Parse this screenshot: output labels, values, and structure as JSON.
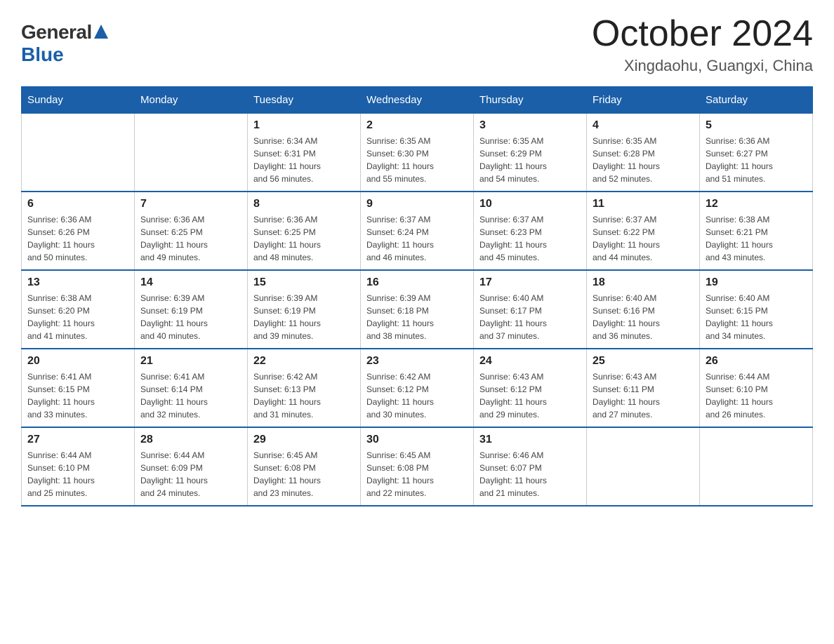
{
  "header": {
    "logo_general": "General",
    "logo_blue": "Blue",
    "month_title": "October 2024",
    "location": "Xingdaohu, Guangxi, China"
  },
  "days_of_week": [
    "Sunday",
    "Monday",
    "Tuesday",
    "Wednesday",
    "Thursday",
    "Friday",
    "Saturday"
  ],
  "weeks": [
    [
      {
        "day": "",
        "info": ""
      },
      {
        "day": "",
        "info": ""
      },
      {
        "day": "1",
        "info": "Sunrise: 6:34 AM\nSunset: 6:31 PM\nDaylight: 11 hours\nand 56 minutes."
      },
      {
        "day": "2",
        "info": "Sunrise: 6:35 AM\nSunset: 6:30 PM\nDaylight: 11 hours\nand 55 minutes."
      },
      {
        "day": "3",
        "info": "Sunrise: 6:35 AM\nSunset: 6:29 PM\nDaylight: 11 hours\nand 54 minutes."
      },
      {
        "day": "4",
        "info": "Sunrise: 6:35 AM\nSunset: 6:28 PM\nDaylight: 11 hours\nand 52 minutes."
      },
      {
        "day": "5",
        "info": "Sunrise: 6:36 AM\nSunset: 6:27 PM\nDaylight: 11 hours\nand 51 minutes."
      }
    ],
    [
      {
        "day": "6",
        "info": "Sunrise: 6:36 AM\nSunset: 6:26 PM\nDaylight: 11 hours\nand 50 minutes."
      },
      {
        "day": "7",
        "info": "Sunrise: 6:36 AM\nSunset: 6:25 PM\nDaylight: 11 hours\nand 49 minutes."
      },
      {
        "day": "8",
        "info": "Sunrise: 6:36 AM\nSunset: 6:25 PM\nDaylight: 11 hours\nand 48 minutes."
      },
      {
        "day": "9",
        "info": "Sunrise: 6:37 AM\nSunset: 6:24 PM\nDaylight: 11 hours\nand 46 minutes."
      },
      {
        "day": "10",
        "info": "Sunrise: 6:37 AM\nSunset: 6:23 PM\nDaylight: 11 hours\nand 45 minutes."
      },
      {
        "day": "11",
        "info": "Sunrise: 6:37 AM\nSunset: 6:22 PM\nDaylight: 11 hours\nand 44 minutes."
      },
      {
        "day": "12",
        "info": "Sunrise: 6:38 AM\nSunset: 6:21 PM\nDaylight: 11 hours\nand 43 minutes."
      }
    ],
    [
      {
        "day": "13",
        "info": "Sunrise: 6:38 AM\nSunset: 6:20 PM\nDaylight: 11 hours\nand 41 minutes."
      },
      {
        "day": "14",
        "info": "Sunrise: 6:39 AM\nSunset: 6:19 PM\nDaylight: 11 hours\nand 40 minutes."
      },
      {
        "day": "15",
        "info": "Sunrise: 6:39 AM\nSunset: 6:19 PM\nDaylight: 11 hours\nand 39 minutes."
      },
      {
        "day": "16",
        "info": "Sunrise: 6:39 AM\nSunset: 6:18 PM\nDaylight: 11 hours\nand 38 minutes."
      },
      {
        "day": "17",
        "info": "Sunrise: 6:40 AM\nSunset: 6:17 PM\nDaylight: 11 hours\nand 37 minutes."
      },
      {
        "day": "18",
        "info": "Sunrise: 6:40 AM\nSunset: 6:16 PM\nDaylight: 11 hours\nand 36 minutes."
      },
      {
        "day": "19",
        "info": "Sunrise: 6:40 AM\nSunset: 6:15 PM\nDaylight: 11 hours\nand 34 minutes."
      }
    ],
    [
      {
        "day": "20",
        "info": "Sunrise: 6:41 AM\nSunset: 6:15 PM\nDaylight: 11 hours\nand 33 minutes."
      },
      {
        "day": "21",
        "info": "Sunrise: 6:41 AM\nSunset: 6:14 PM\nDaylight: 11 hours\nand 32 minutes."
      },
      {
        "day": "22",
        "info": "Sunrise: 6:42 AM\nSunset: 6:13 PM\nDaylight: 11 hours\nand 31 minutes."
      },
      {
        "day": "23",
        "info": "Sunrise: 6:42 AM\nSunset: 6:12 PM\nDaylight: 11 hours\nand 30 minutes."
      },
      {
        "day": "24",
        "info": "Sunrise: 6:43 AM\nSunset: 6:12 PM\nDaylight: 11 hours\nand 29 minutes."
      },
      {
        "day": "25",
        "info": "Sunrise: 6:43 AM\nSunset: 6:11 PM\nDaylight: 11 hours\nand 27 minutes."
      },
      {
        "day": "26",
        "info": "Sunrise: 6:44 AM\nSunset: 6:10 PM\nDaylight: 11 hours\nand 26 minutes."
      }
    ],
    [
      {
        "day": "27",
        "info": "Sunrise: 6:44 AM\nSunset: 6:10 PM\nDaylight: 11 hours\nand 25 minutes."
      },
      {
        "day": "28",
        "info": "Sunrise: 6:44 AM\nSunset: 6:09 PM\nDaylight: 11 hours\nand 24 minutes."
      },
      {
        "day": "29",
        "info": "Sunrise: 6:45 AM\nSunset: 6:08 PM\nDaylight: 11 hours\nand 23 minutes."
      },
      {
        "day": "30",
        "info": "Sunrise: 6:45 AM\nSunset: 6:08 PM\nDaylight: 11 hours\nand 22 minutes."
      },
      {
        "day": "31",
        "info": "Sunrise: 6:46 AM\nSunset: 6:07 PM\nDaylight: 11 hours\nand 21 minutes."
      },
      {
        "day": "",
        "info": ""
      },
      {
        "day": "",
        "info": ""
      }
    ]
  ]
}
